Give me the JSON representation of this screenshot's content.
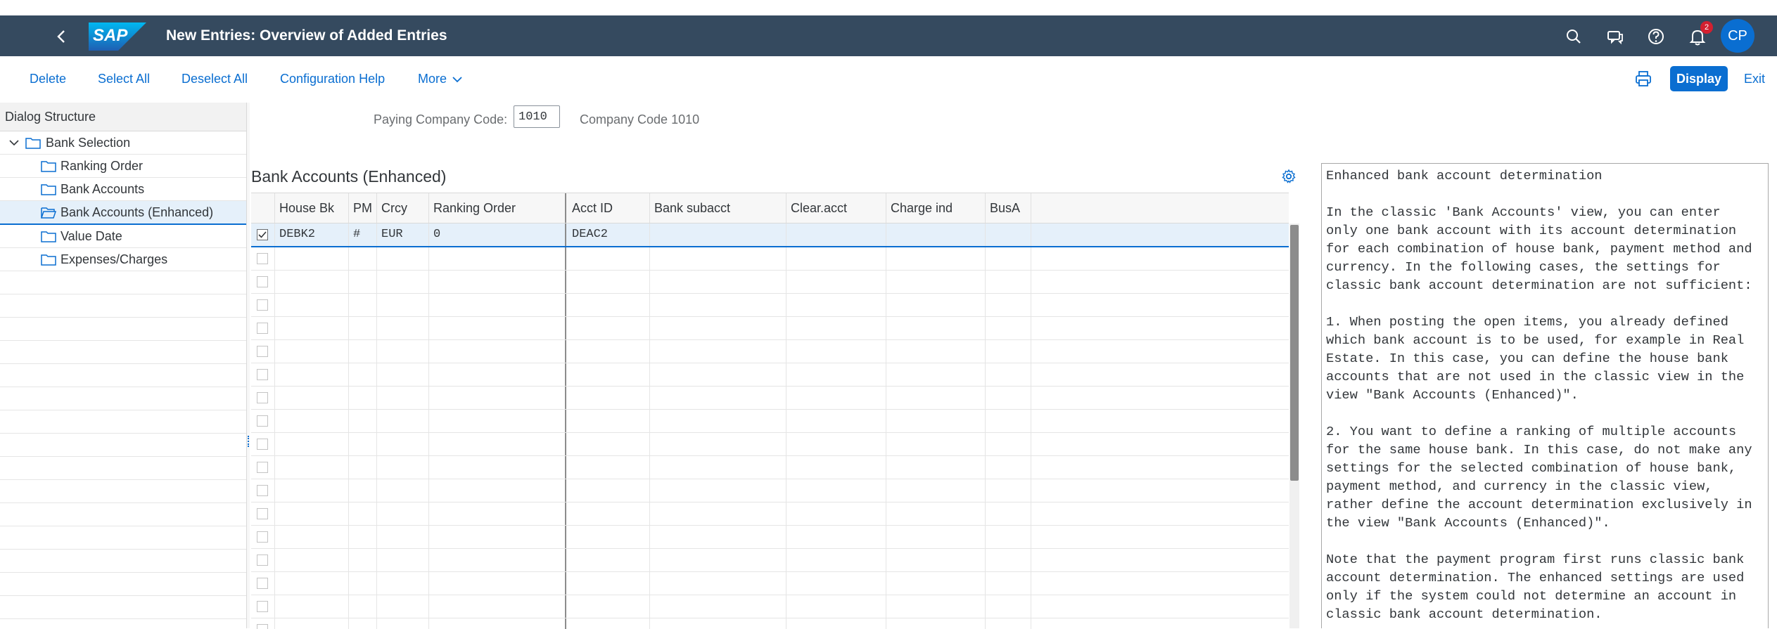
{
  "shell": {
    "title": "New Entries: Overview of Added Entries",
    "logo_text": "SAP",
    "notification_count": "2",
    "avatar_initials": "CP",
    "bg_color": "#354a5f",
    "icons": [
      "back-icon",
      "search-icon",
      "feedback-icon",
      "help-icon",
      "notifications-icon"
    ]
  },
  "toolbar": {
    "delete": "Delete",
    "select_all": "Select All",
    "deselect_all": "Deselect All",
    "config_help": "Configuration Help",
    "more": "More",
    "display": "Display",
    "exit": "Exit",
    "accent_color": "#0a6ed1"
  },
  "tree": {
    "header": "Dialog Structure",
    "items": [
      {
        "label": "Bank Selection"
      },
      {
        "label": "Ranking Order"
      },
      {
        "label": "Bank Accounts"
      },
      {
        "label": "Bank Accounts (Enhanced)"
      },
      {
        "label": "Value Date"
      },
      {
        "label": "Expenses/Charges"
      }
    ]
  },
  "filter": {
    "label": "Paying Company Code:",
    "value": "1010",
    "description": "Company Code 1010"
  },
  "table": {
    "title": "Bank Accounts (Enhanced)",
    "columns": [
      "House Bk",
      "PM",
      "Crcy",
      "Ranking Order",
      "Acct ID",
      "Bank subacct",
      "Clear.acct",
      "Charge ind",
      "BusA"
    ],
    "rows": [
      {
        "selected": true,
        "cells": [
          "DEBK2",
          "#",
          "EUR",
          "0",
          "DEAC2",
          "",
          "",
          "",
          ""
        ]
      }
    ]
  },
  "help_panel": {
    "title": "Enhanced bank account determination",
    "p1": [
      "In the classic 'Bank Accounts' view, you can enter",
      "only one bank account with its account determination",
      "for each combination of house bank, payment method and",
      "currency. In the following cases, the settings for",
      "classic bank account determination are not sufficient:"
    ],
    "p2": [
      "1. When posting the open items, you already defined",
      "which bank account is to be used, for example in Real",
      "Estate. In this case, you can define the house bank",
      "accounts that are not used in the classic view in the",
      "view \"Bank Accounts (Enhanced)\"."
    ],
    "p3": [
      "2. You want to define a ranking of multiple accounts",
      "for the same house bank. In this case, do not make any",
      "settings for the selected combination of house bank,",
      "payment method, and currency in the classic view,",
      "rather define the account determination exclusively in",
      "the view \"Bank Accounts (Enhanced)\"."
    ],
    "p4": [
      "Note that the payment program first runs classic bank",
      "account determination. The enhanced settings are used",
      "only if the system could not determine an account in",
      "classic bank account determination."
    ]
  }
}
